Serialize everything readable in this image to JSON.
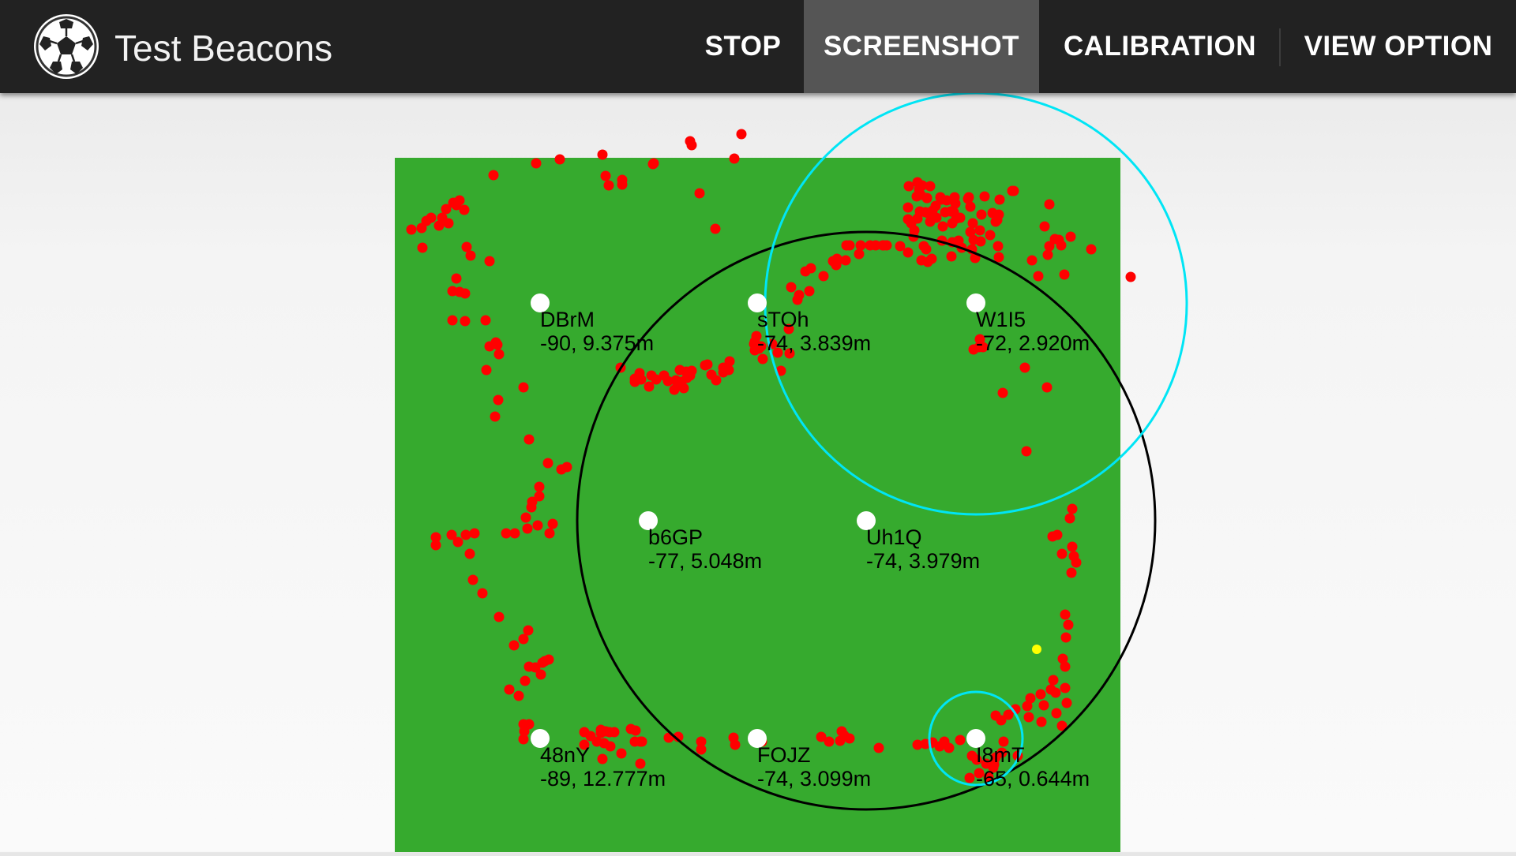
{
  "app": {
    "title": "Test Beacons",
    "icon": "soccer-ball-icon"
  },
  "actions": [
    {
      "label": "STOP",
      "pressed": false
    },
    {
      "label": "SCREENSHOT",
      "pressed": true
    },
    {
      "label": "CALIBRATION",
      "pressed": false
    },
    {
      "label": "VIEW OPTION",
      "pressed": false
    }
  ],
  "colors": {
    "appbar": "#222222",
    "pressed": "#555555",
    "field": "#36aa2e",
    "point": "#ff0000",
    "beacon": "#ffffff",
    "range_circle": "#00e5f5",
    "estimate_circle": "#000000",
    "estimate_point": "#ffff00"
  },
  "beacons": [
    {
      "id": "DBrM",
      "reading": "-90, 9.375m"
    },
    {
      "id": "sTOh",
      "reading": "-74, 3.839m"
    },
    {
      "id": "W1I5",
      "reading": "-72, 2.920m"
    },
    {
      "id": "b6GP",
      "reading": "-77, 5.048m"
    },
    {
      "id": "Uh1Q",
      "reading": "-74, 3.979m"
    },
    {
      "id": "48nY",
      "reading": "-89, 12.777m"
    },
    {
      "id": "FOJZ",
      "reading": "-74, 3.099m"
    },
    {
      "id": "I8mT",
      "reading": "-65, 0.644m"
    }
  ]
}
